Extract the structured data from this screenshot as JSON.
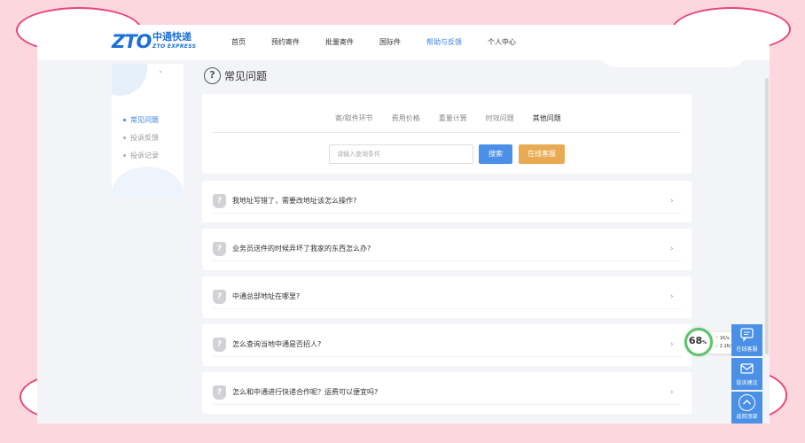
{
  "brand": {
    "logo_mark": "ZTO",
    "logo_cn": "中通快递",
    "logo_en": "ZTO EXPRESS"
  },
  "nav": {
    "items": [
      "首页",
      "预约寄件",
      "批量寄件",
      "国际件",
      "帮助与反馈",
      "个人中心"
    ],
    "active": "帮助与反馈"
  },
  "sidebar": {
    "items": [
      "常见问题",
      "投诉反馈",
      "投诉记录"
    ],
    "active": "常见问题"
  },
  "page": {
    "title_icon": "?",
    "title": "常见问题"
  },
  "tabs": {
    "items": [
      "寄/取件环节",
      "费用价格",
      "重量计算",
      "时效问题",
      "其他问题"
    ],
    "active": "其他问题"
  },
  "search": {
    "placeholder": "请输入查询条件",
    "search_label": "搜索",
    "service_label": "在线客服"
  },
  "faq": {
    "icon_glyph": "?",
    "arrow_glyph": "›",
    "items": [
      "我地址写错了，需要改地址该怎么操作?",
      "业务员送件的时候弄坏了我家的东西怎么办?",
      "中通总部地址在哪里?",
      "怎么查询当地中通是否招人?",
      "怎么和中通进行快递合作呢？运费可以便宜吗?"
    ]
  },
  "speed_widget": {
    "percent": "68",
    "unit": "%",
    "upload": "1K/s",
    "download": "2.2K/s"
  },
  "float_buttons": [
    {
      "icon": "chat-icon",
      "label": "在线客服"
    },
    {
      "icon": "envelope-icon",
      "label": "投诉建议"
    },
    {
      "icon": "arrow-up-icon",
      "label": "返回顶部"
    }
  ],
  "colors": {
    "accent": "#3d83e6",
    "button_blue": "#4a90e6",
    "button_orange": "#e8aa52",
    "page_bg": "#fcd7de",
    "ellipse_border": "#e9457a"
  }
}
